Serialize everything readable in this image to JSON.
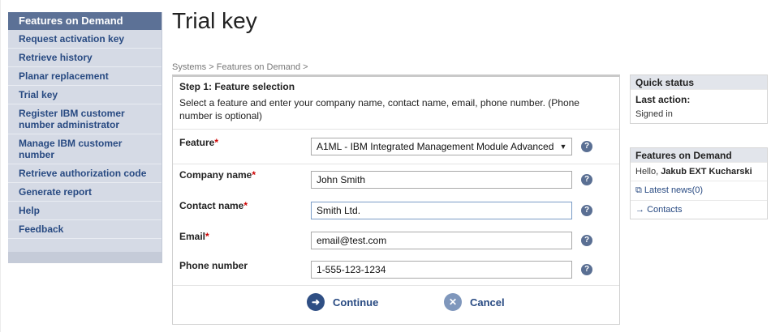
{
  "title": "Trial key",
  "nav": {
    "header": "Features on Demand",
    "items": [
      "Request activation key",
      "Retrieve history",
      "Planar replacement",
      "Trial key",
      "Register IBM customer number administrator",
      "Manage IBM customer number",
      "Retrieve authorization code",
      "Generate report",
      "Help",
      "Feedback"
    ]
  },
  "breadcrumb": {
    "items": [
      "Systems",
      "Features on Demand"
    ],
    "separator": ">"
  },
  "form": {
    "step_title": "Step 1: Feature selection",
    "description": "Select a feature and enter your company name, contact name, email, phone number. (Phone number is optional)",
    "required_mark": "*",
    "feature": {
      "label": "Feature",
      "value": "A1ML - IBM Integrated Management Module Advanced"
    },
    "company": {
      "label": "Company name",
      "value": "John Smith"
    },
    "contact": {
      "label": "Contact name",
      "value": "Smith Ltd."
    },
    "email": {
      "label": "Email",
      "value": "email@test.com"
    },
    "phone": {
      "label": "Phone number",
      "value": "1-555-123-1234"
    },
    "help_glyph": "?",
    "continue_label": "Continue",
    "cancel_label": "Cancel"
  },
  "quick_status": {
    "title": "Quick status",
    "last_action_label": "Last action:",
    "last_action_value": "Signed in"
  },
  "fod_box": {
    "title": "Features on Demand",
    "hello_prefix": "Hello, ",
    "user_name": "Jakub EXT Kucharski",
    "latest_news": "Latest news(0)",
    "contacts": "Contacts"
  },
  "colors": {
    "nav_header_bg": "#5c7196",
    "nav_bg": "#d5dae5",
    "link": "#284a82",
    "required": "#cc0000"
  }
}
